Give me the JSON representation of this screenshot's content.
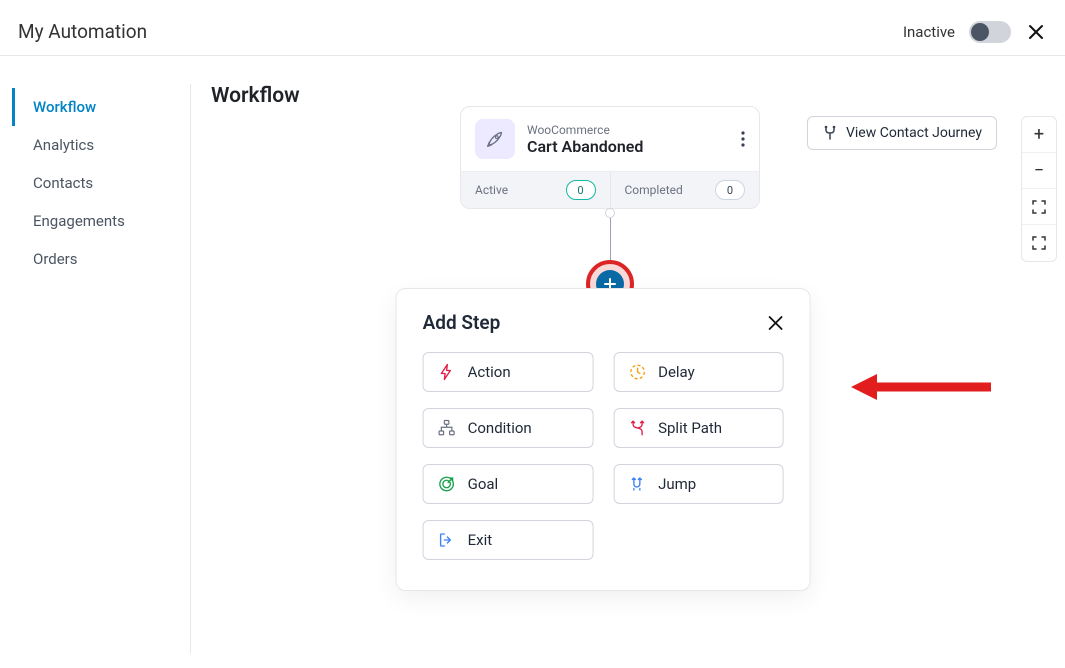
{
  "header": {
    "title": "My Automation",
    "status_label": "Inactive"
  },
  "sidebar": {
    "items": [
      {
        "label": "Workflow",
        "active": true
      },
      {
        "label": "Analytics",
        "active": false
      },
      {
        "label": "Contacts",
        "active": false
      },
      {
        "label": "Engagements",
        "active": false
      },
      {
        "label": "Orders",
        "active": false
      }
    ]
  },
  "canvas": {
    "heading": "Workflow",
    "view_journey_label": "View Contact Journey"
  },
  "trigger_node": {
    "category": "WooCommerce",
    "name": "Cart Abandoned",
    "active_label": "Active",
    "active_count": "0",
    "completed_label": "Completed",
    "completed_count": "0"
  },
  "add_step": {
    "title": "Add Step",
    "options": [
      {
        "label": "Action"
      },
      {
        "label": "Delay"
      },
      {
        "label": "Condition"
      },
      {
        "label": "Split Path"
      },
      {
        "label": "Goal"
      },
      {
        "label": "Jump"
      },
      {
        "label": "Exit"
      }
    ]
  },
  "icon_colors": {
    "action": "#e11d48",
    "delay": "#f59e0b",
    "condition": "#6b7280",
    "split": "#e11d48",
    "goal": "#16a34a",
    "jump": "#3b82f6",
    "exit": "#3b82f6"
  }
}
